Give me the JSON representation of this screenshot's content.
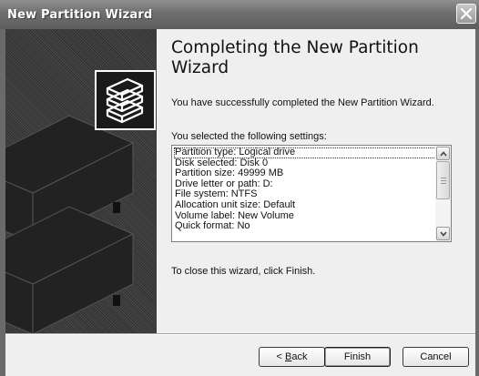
{
  "window": {
    "title": "New Partition Wizard",
    "close_icon": "close-icon"
  },
  "banner": {
    "logo_icon": "stacked-disks-icon"
  },
  "main": {
    "heading": "Completing the New Partition Wizard",
    "intro": "You have successfully completed the New Partition Wizard.",
    "settings_label": "You selected the following settings:",
    "settings": [
      "Partition type: Logical drive",
      "Disk selected: Disk 0",
      "Partition size: 49999 MB",
      "Drive letter or path: D:",
      "File system: NTFS",
      "Allocation unit size: Default",
      "Volume label: New Volume",
      "Quick format: No"
    ],
    "close_note": "To close this wizard, click Finish."
  },
  "buttons": {
    "back_prefix": "< ",
    "back_mnemonic": "B",
    "back_rest": "ack",
    "finish": "Finish",
    "cancel": "Cancel"
  }
}
